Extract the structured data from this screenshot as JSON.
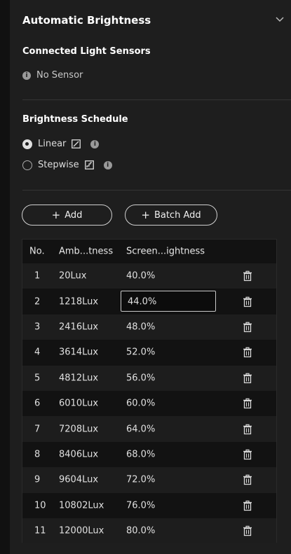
{
  "panel": {
    "title": "Automatic Brightness",
    "collapse_icon": "chevron-down-icon"
  },
  "sensors": {
    "title": "Connected Light Sensors",
    "status_icon": "info-icon",
    "status": "No Sensor"
  },
  "schedule": {
    "title": "Brightness Schedule",
    "options": [
      {
        "label": "Linear",
        "selected": true,
        "icon": "linear-graph-icon"
      },
      {
        "label": "Stepwise",
        "selected": false,
        "icon": "stepwise-graph-icon"
      }
    ]
  },
  "actions": {
    "add_label": "Add",
    "batch_add_label": "Batch Add"
  },
  "table": {
    "headers": [
      "No.",
      "Amb...tness",
      "Screen...ightness"
    ],
    "rows": [
      {
        "no": "1",
        "ambient": "20Lux",
        "screen": "40.0%"
      },
      {
        "no": "2",
        "ambient": "1218Lux",
        "screen": "44.0%",
        "editing": true
      },
      {
        "no": "3",
        "ambient": "2416Lux",
        "screen": "48.0%"
      },
      {
        "no": "4",
        "ambient": "3614Lux",
        "screen": "52.0%"
      },
      {
        "no": "5",
        "ambient": "4812Lux",
        "screen": "56.0%"
      },
      {
        "no": "6",
        "ambient": "6010Lux",
        "screen": "60.0%"
      },
      {
        "no": "7",
        "ambient": "7208Lux",
        "screen": "64.0%"
      },
      {
        "no": "8",
        "ambient": "8406Lux",
        "screen": "68.0%"
      },
      {
        "no": "9",
        "ambient": "9604Lux",
        "screen": "72.0%"
      },
      {
        "no": "10",
        "ambient": "10802Lux",
        "screen": "76.0%"
      },
      {
        "no": "11",
        "ambient": "12000Lux",
        "screen": "80.0%"
      }
    ]
  },
  "colors": {
    "background": "#1e1e1e",
    "table_bg": "#121212",
    "text": "#e6e6e6"
  }
}
